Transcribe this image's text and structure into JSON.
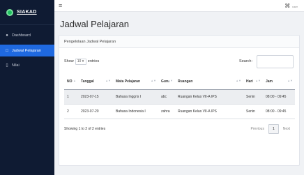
{
  "sidebar": {
    "brand": "SIAKAD",
    "items": [
      {
        "label": "Dashboard",
        "icon": "dashboard-icon"
      },
      {
        "label": "Jadwal Pelajaran",
        "icon": "calendar-icon"
      },
      {
        "label": "Nilai",
        "icon": "document-icon"
      }
    ]
  },
  "topbar": {
    "menu_icon": "menu-icon",
    "user_label": "user"
  },
  "page": {
    "title": "Jadwal Pelajaran"
  },
  "card": {
    "header": "Pengelolaan Jadwal Pelajaran"
  },
  "controls": {
    "show_label": "Show",
    "entries_value": "10",
    "entries_label": "entries",
    "search_label": "Search:"
  },
  "table": {
    "columns": [
      "NO",
      "Tanggal",
      "Mata Pelajaran",
      "Guru",
      "Ruangan",
      "Hari",
      "Jam"
    ],
    "rows": [
      [
        "1",
        "2023-07-15",
        "Bahasa Inggris I",
        "abc",
        "Ruangan Kelas VII-A IPS",
        "Senin",
        "08:00 - 09:45"
      ],
      [
        "2",
        "2023-07-20",
        "Bahasa Indonesia I",
        "zahra",
        "Ruangan Kelas VII-A IPS",
        "Senin",
        "08:00 - 09:45"
      ]
    ]
  },
  "footer": {
    "info": "Showing 1 to 2 of 2 entries",
    "previous": "Previous",
    "page": "1",
    "next": "Next"
  },
  "colors": {
    "sidebar_bg": "#0f1b33",
    "active": "#1f69e0",
    "brand_logo": "#1dbf5f"
  }
}
